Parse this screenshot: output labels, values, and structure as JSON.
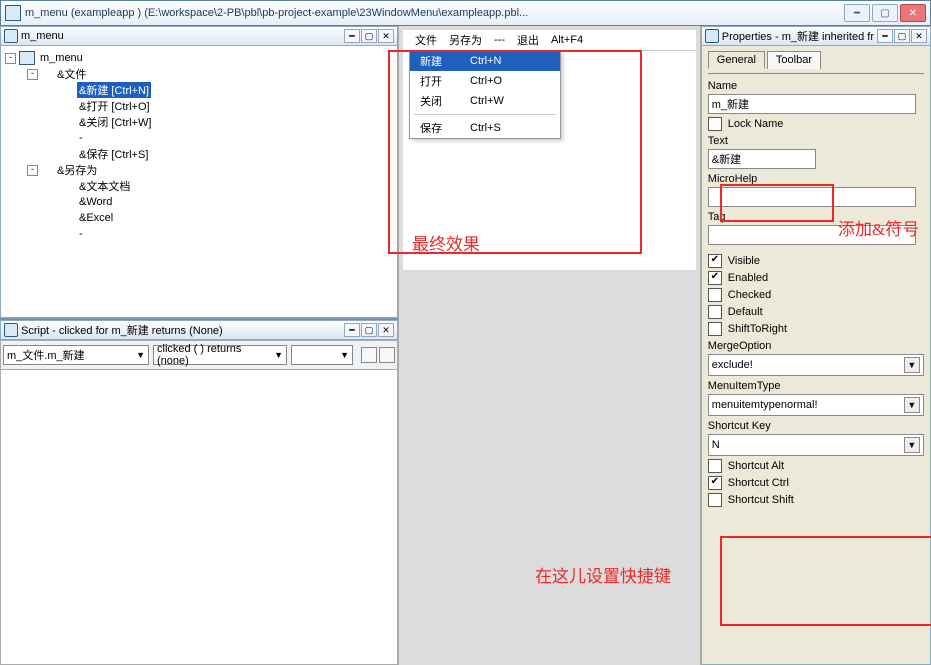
{
  "window": {
    "title": "m_menu (exampleapp ) (E:\\workspace\\2-PB\\pbl\\pb-project-example\\23WindowMenu\\exampleapp.pbl..."
  },
  "treePane": {
    "title": "m_menu"
  },
  "tree": {
    "root": "m_menu",
    "file": "&文件",
    "new": "&新建  [Ctrl+N]",
    "open": "&打开  [Ctrl+O]",
    "close": "&关闭  [Ctrl+W]",
    "dash": "-",
    "save": "&保存  [Ctrl+S]",
    "saveas": "&另存为",
    "txt": "&文本文档",
    "word": "&Word",
    "excel": "&Excel",
    "dash2": "-"
  },
  "scriptPane": {
    "title": "Script - clicked for m_新建 returns (None)",
    "obj": "m_文件.m_新建",
    "evt": "clicked ( ) returns (none)"
  },
  "preview": {
    "m_file": "文件",
    "m_saveas": "另存为",
    "m_dash": "---",
    "m_exit": "退出",
    "m_exit_sc": "Alt+F4",
    "dd_new": "新建",
    "dd_new_sc": "Ctrl+N",
    "dd_open": "打开",
    "dd_open_sc": "Ctrl+O",
    "dd_close": "关闭",
    "dd_close_sc": "Ctrl+W",
    "dd_save": "保存",
    "dd_save_sc": "Ctrl+S"
  },
  "propsPane": {
    "title": "Properties - m_新建  inherited fr"
  },
  "tabs": {
    "general": "General",
    "toolbar": "Toolbar"
  },
  "props": {
    "name_lbl": "Name",
    "name_val": "m_新建",
    "lockname": "Lock Name",
    "text_lbl": "Text",
    "text_val": "&新建",
    "micro_lbl": "MicroHelp",
    "micro_val": "",
    "tag_lbl": "Tag",
    "tag_val": "",
    "visible": "Visible",
    "enabled": "Enabled",
    "checked": "Checked",
    "default": "Default",
    "shifttoright": "ShiftToRight",
    "mergeopt_lbl": "MergeOption",
    "mergeopt_val": "exclude!",
    "mitype_lbl": "MenuItemType",
    "mitype_val": "menuitemtypenormal!",
    "sckey_lbl": "Shortcut Key",
    "sckey_val": "N",
    "scalt": "Shortcut Alt",
    "scctrl": "Shortcut Ctrl",
    "scshift": "Shortcut Shift"
  },
  "annot": {
    "final": "最终效果",
    "addamp": "添加&符号",
    "sethot": "在这儿设置快捷键"
  }
}
